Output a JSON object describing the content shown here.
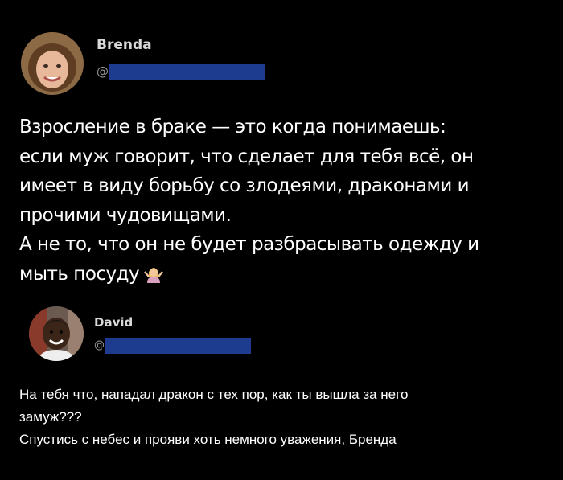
{
  "colors": {
    "background": "#000000",
    "handle_redaction": "#1d3b8f",
    "name": "#d9d9d9",
    "at_sign": "#9a9a9a"
  },
  "posts": [
    {
      "author": "Brenda",
      "at_sign": "@",
      "avatar_icon": "woman-avatar",
      "lines": [
        "Взросление в браке — это когда понимаешь:",
        "если муж говорит, что сделает для тебя всё, он",
        "имеет в виду борьбу со злодеями, драконами и",
        "прочими чудовищами.",
        "А не то, что он не будет разбрасывать одежду и",
        "мыть посуду"
      ],
      "emoji_icon": "shrugging-woman-emoji"
    },
    {
      "author": "David",
      "at_sign": "@",
      "avatar_icon": "man-avatar",
      "lines": [
        "На тебя что, нападал дракон с тех пор, как ты вышла за него",
        "замуж???",
        "Спустись с небес и прояви хоть немного уважения, Бренда"
      ]
    }
  ]
}
